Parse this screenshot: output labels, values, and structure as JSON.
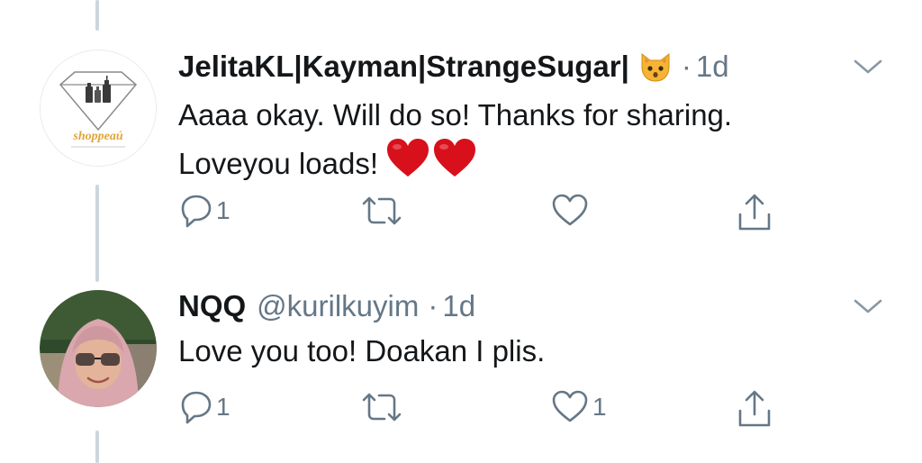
{
  "colors": {
    "text_primary": "#14171a",
    "text_secondary": "#657786",
    "thread_line": "#ccd6dd",
    "heart_red": "#d8101b"
  },
  "tweets": [
    {
      "display_name": "JelitaKL|Kayman|StrangeSugar|",
      "name_emoji": "cat-face-emoji",
      "handle": "",
      "separator": "·",
      "time": "1d",
      "avatar": {
        "type": "shop-logo",
        "logo_text": "shoppeaú"
      },
      "text_lines": [
        "Aaaa okay. Will do so! Thanks for sharing.",
        "Loveyou loads!"
      ],
      "trailing_emoji": [
        "red-heart-emoji",
        "red-heart-emoji"
      ],
      "actions": {
        "reply_count": "1",
        "retweet_count": "",
        "like_count": "",
        "icons": [
          "reply-icon",
          "retweet-icon",
          "like-icon",
          "share-icon"
        ]
      }
    },
    {
      "display_name": "NQQ",
      "handle": "@kurilkuyim",
      "separator": "·",
      "time": "1d",
      "avatar": {
        "type": "user-photo"
      },
      "text_lines": [
        "Love you too! Doakan I plis."
      ],
      "actions": {
        "reply_count": "1",
        "retweet_count": "",
        "like_count": "1",
        "icons": [
          "reply-icon",
          "retweet-icon",
          "like-icon",
          "share-icon"
        ]
      }
    }
  ]
}
